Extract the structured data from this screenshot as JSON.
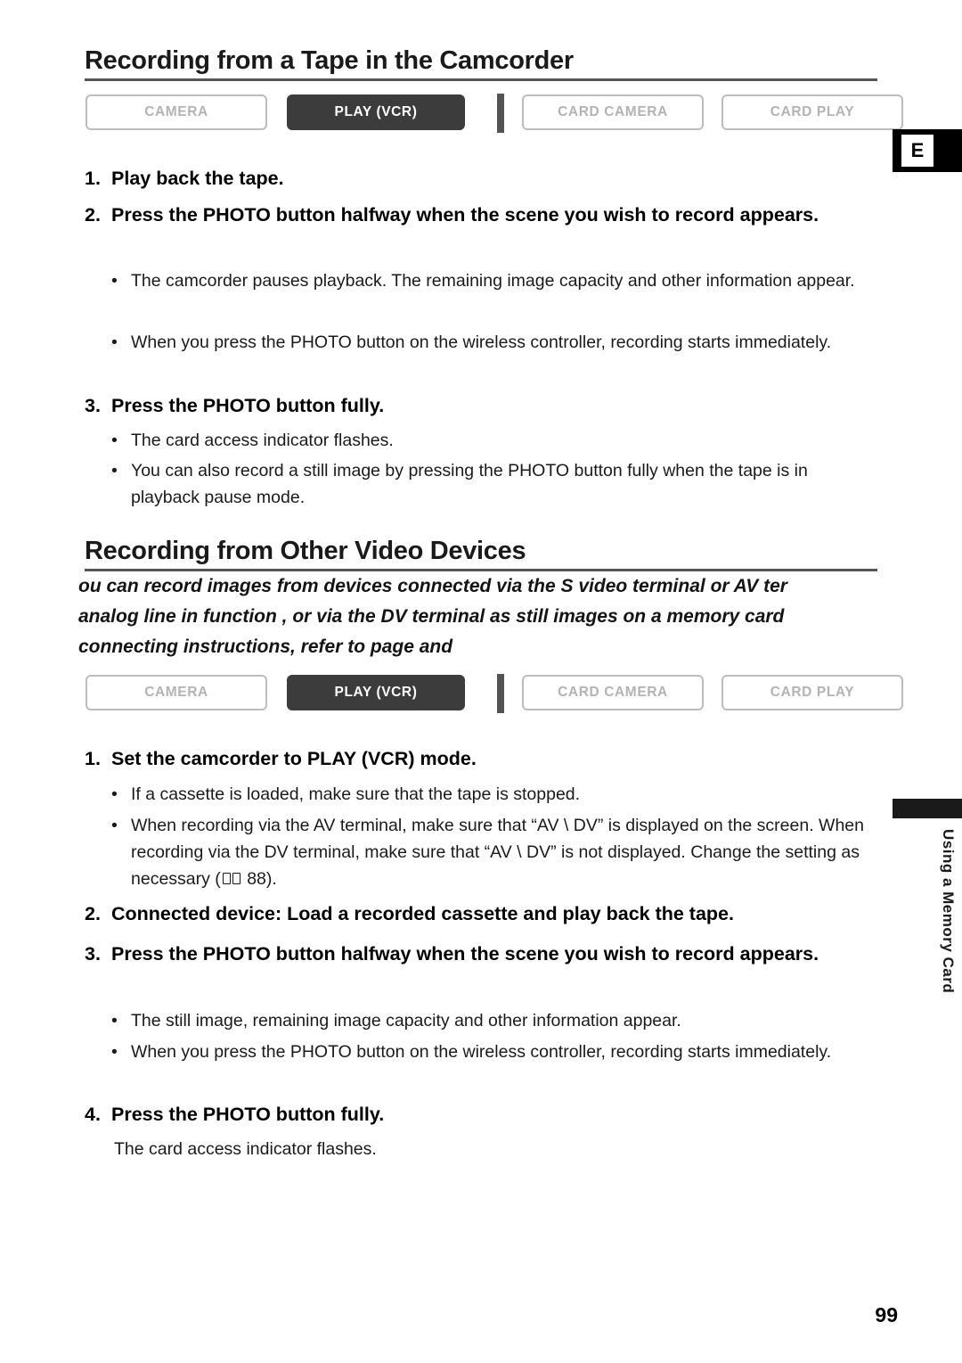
{
  "page": {
    "number": "99",
    "edge_tab_label": "E",
    "running_head": "Using a Memory Card"
  },
  "sections": [
    {
      "heading": "Recording from a Tape in the Camcorder",
      "modes": [
        {
          "label": "CAMERA",
          "active": false
        },
        {
          "label": "PLAY (VCR)",
          "active": true
        },
        {
          "label": "CARD CAMERA",
          "active": false
        },
        {
          "label": "CARD PLAY",
          "active": false
        }
      ],
      "steps": [
        {
          "num": "1.",
          "text": "Play back the tape."
        },
        {
          "num": "2.",
          "text": "Press the PHOTO button halfway when the scene you wish to record appears."
        }
      ],
      "bullets_a": [
        "The camcorder pauses playback. The remaining image capacity and other information appear.",
        "When you press the PHOTO button on the wireless controller, recording starts immediately."
      ],
      "step3": {
        "num": "3.",
        "text": "Press the PHOTO button fully."
      },
      "bullets_b": [
        "The card access indicator flashes.",
        "You can also record a still image by pressing the PHOTO button fully when the tape is in playback pause mode."
      ]
    },
    {
      "heading": "Recording from Other Video Devices",
      "intro_lines": [
        "ou can record images from devices connected via the S video terminal or AV ter",
        "analog line in function , or via the DV terminal as still images on a memory card",
        "connecting instructions, refer to page      and"
      ],
      "modes": [
        {
          "label": "CAMERA",
          "active": false
        },
        {
          "label": "PLAY (VCR)",
          "active": true
        },
        {
          "label": "CARD CAMERA",
          "active": false
        },
        {
          "label": "CARD PLAY",
          "active": false
        }
      ],
      "step1": {
        "num": "1.",
        "text": "Set the camcorder to PLAY (VCR) mode."
      },
      "bullets_a": [
        "If a cassette is loaded, make sure that the tape is stopped.",
        "When recording via the AV terminal, make sure that “AV \\ DV” is displayed on the screen. When recording via the DV terminal, make sure that “AV \\ DV” is not displayed. Change the setting as necessary ("
      ],
      "bullet_ref_suffix": " 88).",
      "step2": {
        "num": "2.",
        "text": "Connected device: Load a recorded cassette and play back the tape."
      },
      "step3": {
        "num": "3.",
        "text": "Press the PHOTO button halfway when the scene you wish to record appears."
      },
      "bullets_b": [
        "The still image, remaining image capacity and other information appear.",
        "When you press the PHOTO button on the wireless controller, recording starts immediately."
      ],
      "step4": {
        "num": "4.",
        "text": "Press the PHOTO button fully."
      },
      "final_note": "The card access indicator flashes."
    }
  ]
}
